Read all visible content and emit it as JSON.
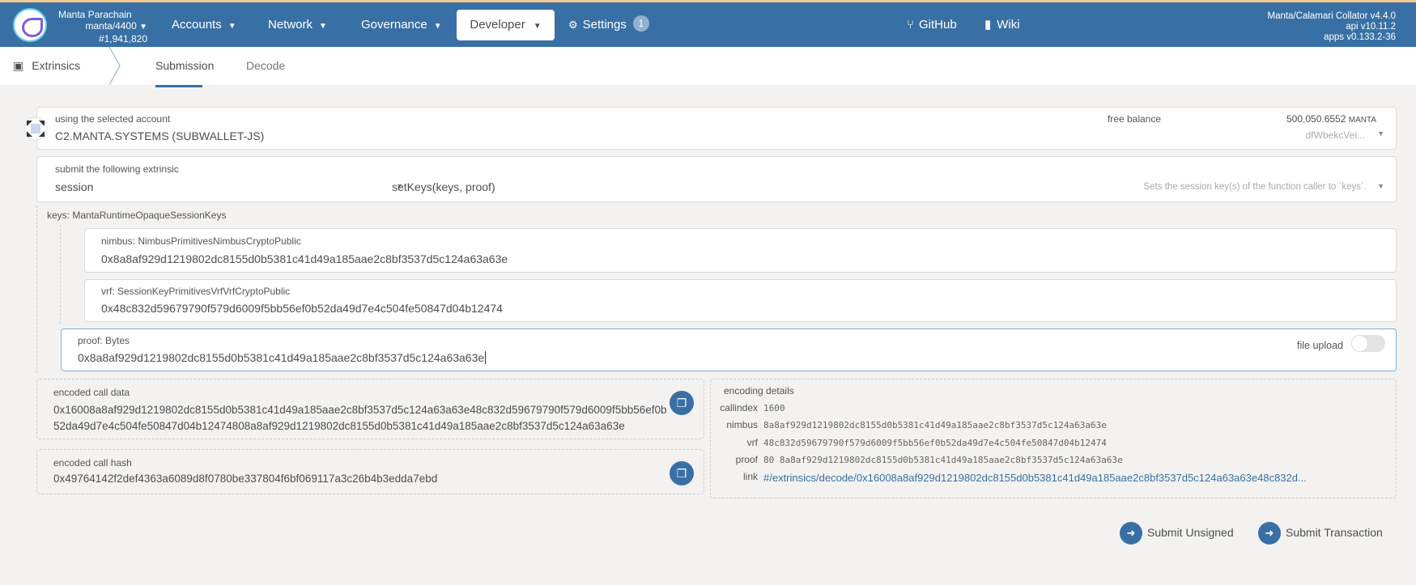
{
  "header": {
    "chain_name": "Manta Parachain",
    "chain_spec": "manta/4400",
    "block": "#1,941,820",
    "nav": [
      {
        "label": "Accounts"
      },
      {
        "label": "Network"
      },
      {
        "label": "Governance"
      },
      {
        "label": "Developer"
      },
      {
        "label": "Settings",
        "badge": "1"
      }
    ],
    "links": [
      {
        "label": "GitHub"
      },
      {
        "label": "Wiki"
      }
    ],
    "version": [
      "Manta/Calamari Collator v4.4.0",
      "api v10.11.2",
      "apps v0.133.2-36"
    ]
  },
  "subnav": {
    "section": "Extrinsics",
    "tabs": [
      "Submission",
      "Decode"
    ],
    "active": "Submission"
  },
  "account": {
    "label": "using the selected account",
    "value": "C2.MANTA.SYSTEMS (SUBWALLET-JS)",
    "balance_label": "free balance",
    "balance": "500,050.6552",
    "unit": "MANTA",
    "address": "dfWbekcVei..."
  },
  "extrinsic": {
    "label": "submit the following extrinsic",
    "module": "session",
    "method": "setKeys(keys, proof)",
    "doc": "Sets the session key(s) of the function caller to `keys`."
  },
  "keys": {
    "label": "keys: MantaRuntimeOpaqueSessionKeys",
    "nimbus": {
      "label": "nimbus: NimbusPrimitivesNimbusCryptoPublic",
      "value": "0x8a8af929d1219802dc8155d0b5381c41d49a185aae2c8bf3537d5c124a63a63e"
    },
    "vrf": {
      "label": "vrf: SessionKeyPrimitivesVrfVrfCryptoPublic",
      "value": "0x48c832d59679790f579d6009f5bb56ef0b52da49d7e4c504fe50847d04b12474"
    }
  },
  "proof": {
    "label": "proof: Bytes",
    "value": "0x8a8af929d1219802dc8155d0b5381c41d49a185aae2c8bf3537d5c124a63a63e",
    "file_upload_label": "file upload",
    "file_upload": false
  },
  "encoded": {
    "data_label": "encoded call data",
    "data_line1": "0x16008a8af929d1219802dc8155d0b5381c41d49a185aae2c8bf3537d5c124a63a63e48c832d59679790f579d6009f5bb56ef0b",
    "data_line2": "52da49d7e4c504fe50847d04b12474808a8af929d1219802dc8155d0b5381c41d49a185aae2c8bf3537d5c124a63a63e",
    "hash_label": "encoded call hash",
    "hash": "0x49764142f2def4363a6089d8f0780be337804f6bf069117a3c26b4b3edda7ebd"
  },
  "details": {
    "label": "encoding details",
    "rows": [
      {
        "k": "callindex",
        "v": "1600"
      },
      {
        "k": "nimbus",
        "v": "8a8af929d1219802dc8155d0b5381c41d49a185aae2c8bf3537d5c124a63a63e"
      },
      {
        "k": "vrf",
        "v": "48c832d59679790f579d6009f5bb56ef0b52da49d7e4c504fe50847d04b12474"
      },
      {
        "k": "proof",
        "v": "80 8a8af929d1219802dc8155d0b5381c41d49a185aae2c8bf3537d5c124a63a63e"
      },
      {
        "k": "link",
        "v": "#/extrinsics/decode/0x16008a8af929d1219802dc8155d0b5381c41d49a185aae2c8bf3537d5c124a63a63e48c832d..."
      }
    ]
  },
  "actions": {
    "unsigned": "Submit Unsigned",
    "signed": "Submit Transaction"
  },
  "colors": {
    "brand": "#3870a5",
    "link": "#3870a5"
  }
}
